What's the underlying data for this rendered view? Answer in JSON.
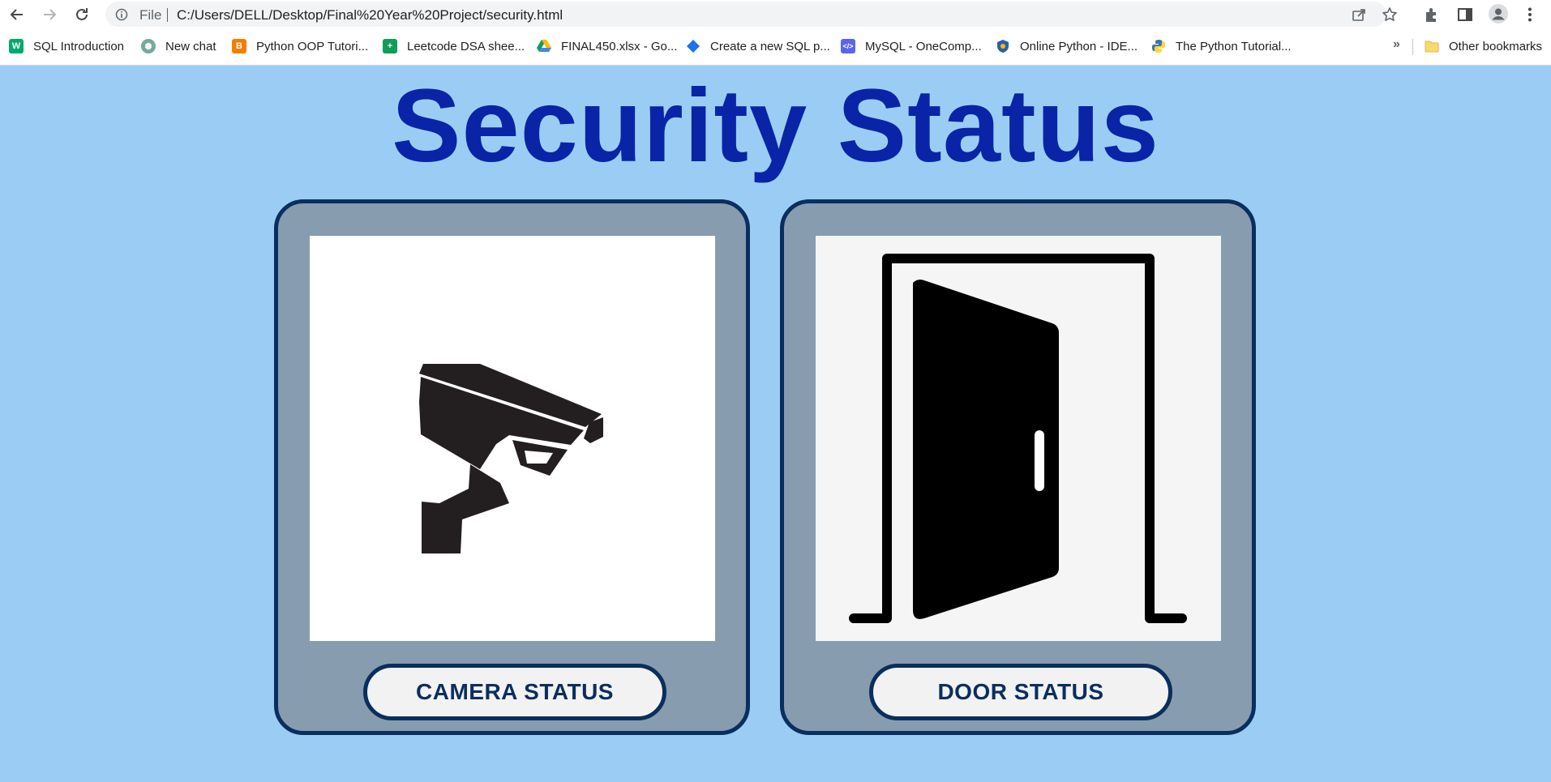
{
  "browser": {
    "address_scheme": "File",
    "url": "C:/Users/DELL/Desktop/Final%20Year%20Project/security.html",
    "bookmarks": [
      {
        "label": "SQL Introduction",
        "icon": "w3schools-icon",
        "color": "#04aa6d"
      },
      {
        "label": "New chat",
        "icon": "chatgpt-icon",
        "color": "#74aa9c"
      },
      {
        "label": "Python OOP Tutori...",
        "icon": "blogger-icon",
        "color": "#f57d00"
      },
      {
        "label": "Leetcode DSA shee...",
        "icon": "google-sheets-icon",
        "color": "#0f9d58"
      },
      {
        "label": "FINAL450.xlsx - Go...",
        "icon": "google-drive-icon",
        "color": "#fbbc04"
      },
      {
        "label": "Create a new SQL p...",
        "icon": "dbfiddle-icon",
        "color": "#1a73e8"
      },
      {
        "label": "MySQL - OneComp...",
        "icon": "onecompiler-icon",
        "color": "#5865f2"
      },
      {
        "label": "Online Python - IDE...",
        "icon": "online-python-icon",
        "color": "#2c5fa8"
      },
      {
        "label": "The Python Tutorial...",
        "icon": "python-icon",
        "color": "#3776ab"
      }
    ],
    "more_bookmarks": "»",
    "other_bookmarks": "Other bookmarks"
  },
  "page": {
    "title": "Security Status",
    "cards": [
      {
        "image_icon": "cctv-camera-icon",
        "button_label": "CAMERA STATUS"
      },
      {
        "image_icon": "open-door-icon",
        "button_label": "DOOR STATUS"
      }
    ]
  },
  "colors": {
    "page_background": "#9bcdf4",
    "title": "#0a24a8",
    "card_background": "#879daf",
    "card_border": "#0a2e5e"
  }
}
